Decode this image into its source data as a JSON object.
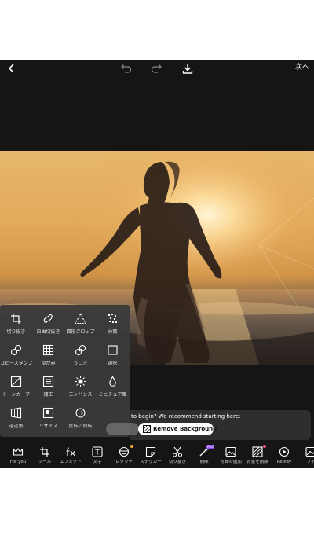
{
  "header": {
    "back_icon": "chevron-left-icon",
    "undo_icon": "undo-icon",
    "redo_icon": "redo-icon",
    "download_icon": "download-icon",
    "next_label": "次へ"
  },
  "tools": [
    {
      "label": "切り抜き",
      "icon": "crop-icon"
    },
    {
      "label": "自由切抜き",
      "icon": "freeform-cut-icon"
    },
    {
      "label": "図形クロップ",
      "icon": "shape-crop-icon"
    },
    {
      "label": "分散",
      "icon": "dispersion-icon"
    },
    {
      "label": "コピースタンプ",
      "icon": "clone-stamp-icon"
    },
    {
      "label": "ゆがみ",
      "icon": "warp-grid-icon"
    },
    {
      "label": "うごき",
      "icon": "motion-icon"
    },
    {
      "label": "選択",
      "icon": "select-icon"
    },
    {
      "label": "トーンカーブ",
      "icon": "tone-curve-icon"
    },
    {
      "label": "補正",
      "icon": "adjust-icon"
    },
    {
      "label": "エンハンス",
      "icon": "enhance-icon"
    },
    {
      "label": "ミニチュア風",
      "icon": "tilt-shift-icon"
    },
    {
      "label": "遠近感",
      "icon": "perspective-icon"
    },
    {
      "label": "リサイズ",
      "icon": "resize-icon"
    },
    {
      "label": "反転／回転",
      "icon": "flip-rotate-icon"
    }
  ],
  "recommendation": {
    "text": "to begin? We recommend starting here:",
    "button_label": "Remove Background",
    "button_icon": "remove-background-icon"
  },
  "nav": [
    {
      "label": "For you",
      "icon": "crown-icon"
    },
    {
      "label": "ツール",
      "icon": "crop-tool-icon"
    },
    {
      "label": "エフェクト",
      "icon": "fx-icon"
    },
    {
      "label": "文字",
      "icon": "text-icon"
    },
    {
      "label": "レタッチ",
      "icon": "retouch-face-icon"
    },
    {
      "label": "ステッカー",
      "icon": "sticker-icon"
    },
    {
      "label": "切り抜き",
      "icon": "scissors-icon"
    },
    {
      "label": "削除",
      "icon": "magic-eraser-icon",
      "badge": "PRO"
    },
    {
      "label": "写真の追加",
      "icon": "add-photo-icon"
    },
    {
      "label": "背景を削除",
      "icon": "remove-bg-icon"
    },
    {
      "label": "Replay",
      "icon": "replay-icon"
    },
    {
      "label": "フィ",
      "icon": "filter-icon"
    }
  ],
  "colors": {
    "app_background": "#151515",
    "panel_background": "#3a3a3a",
    "pro_badge": "#8a3ff0",
    "notification_dot": "#f4a836",
    "sticker_dot": "#ff4f7b"
  }
}
